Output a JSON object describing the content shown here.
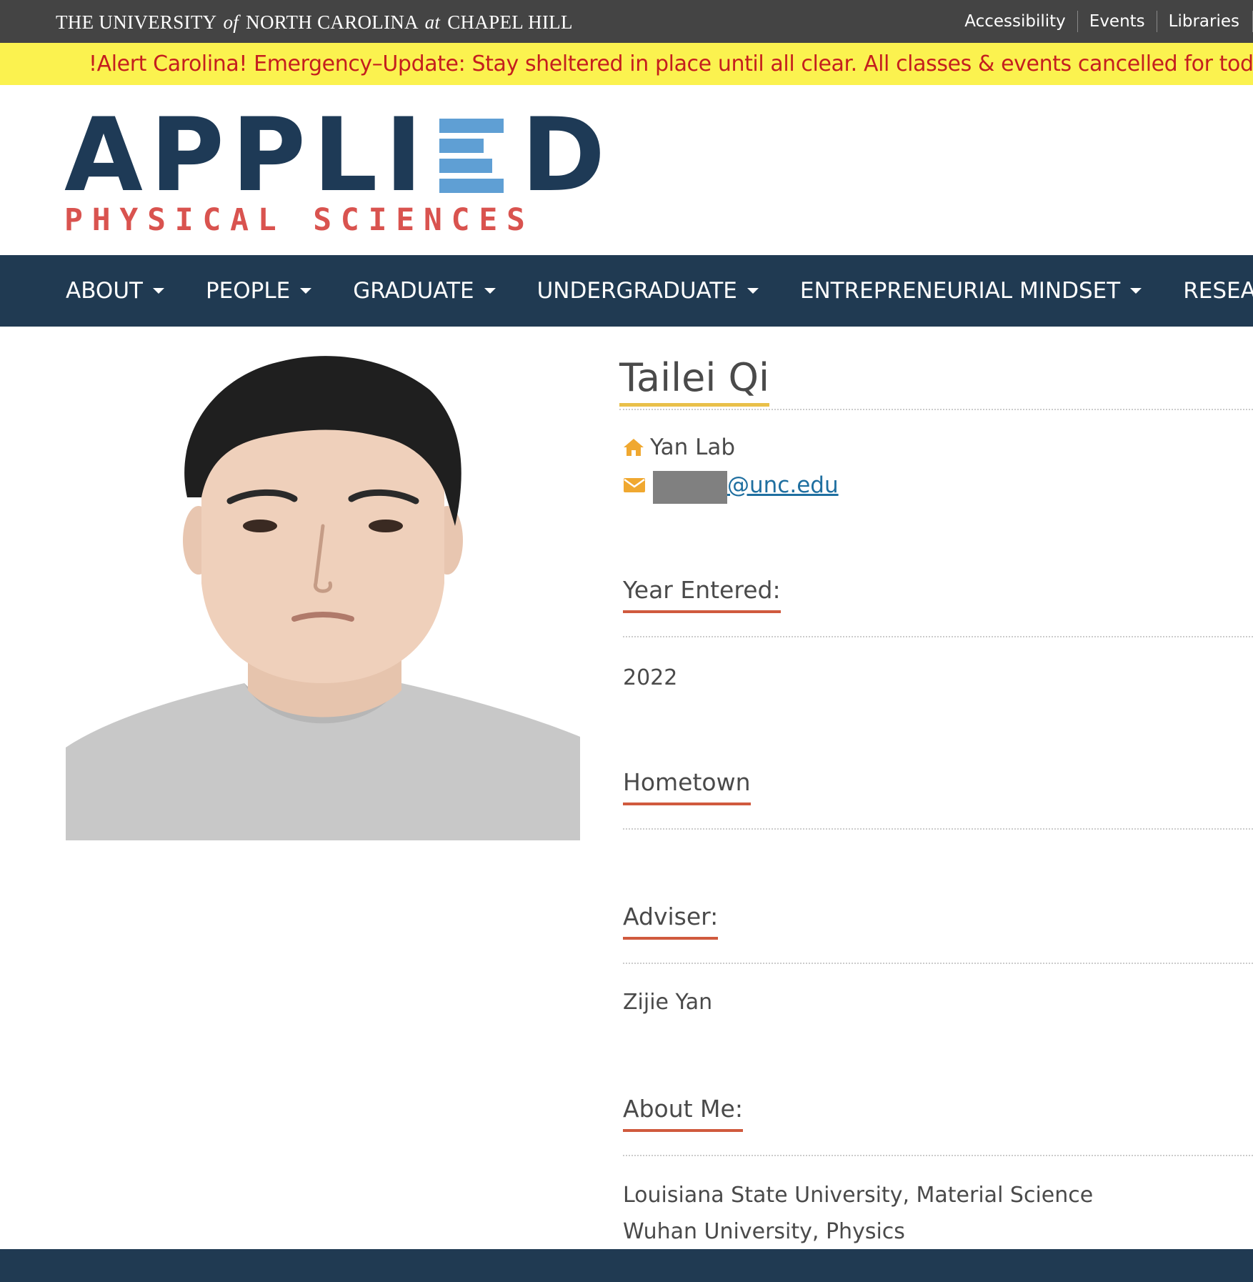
{
  "topbar": {
    "university_prefix": "THE UNIVERSITY",
    "university_of": "of",
    "university_mid": "NORTH CAROLINA",
    "university_at": "at",
    "university_suffix": "CHAPEL HILL",
    "links": [
      "Accessibility",
      "Events",
      "Libraries"
    ]
  },
  "alert": {
    "text": "!Alert Carolina! Emergency–Update: Stay sheltered in place until all clear. All classes & events cancelled for tod"
  },
  "logo": {
    "main_left": "APPLI",
    "main_right": "D",
    "sub": "PHYSICAL SCIENCES",
    "colors": {
      "navy": "#1e3a56",
      "blue": "#5f9fd4",
      "red": "#d9534f"
    }
  },
  "nav": {
    "items": [
      "ABOUT",
      "PEOPLE",
      "GRADUATE",
      "UNDERGRADUATE",
      "ENTREPRENEURIAL MINDSET",
      "RESEARC"
    ]
  },
  "profile": {
    "name": "Tailei Qi",
    "lab": "Yan Lab",
    "email_suffix": "@unc.edu",
    "icons": {
      "lab": "home-icon",
      "email": "envelope-icon"
    },
    "sections": {
      "year_entered": {
        "title": "Year Entered:",
        "value": "2022"
      },
      "hometown": {
        "title": "Hometown",
        "value": ""
      },
      "adviser": {
        "title": "Adviser:",
        "value": "Zijie Yan"
      },
      "about_me": {
        "title": "About Me:",
        "lines": [
          "Louisiana State University, Material Science",
          "Wuhan University, Physics"
        ]
      }
    }
  },
  "colors": {
    "topbar": "#444444",
    "alert_bg": "#fbf24f",
    "alert_text": "#c41e1e",
    "nav_bg": "#203a52",
    "name_underline": "#e9c04a",
    "section_underline": "#d05a3e",
    "icon_orange": "#f0a830"
  }
}
